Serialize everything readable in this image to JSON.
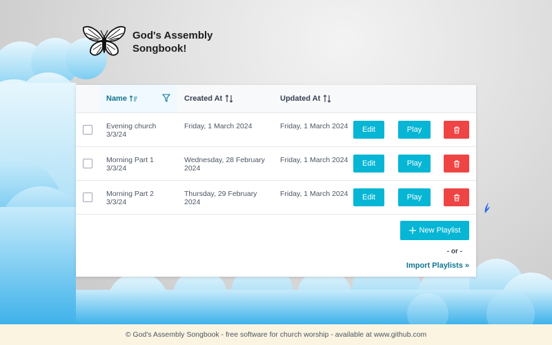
{
  "app": {
    "title": "God's Assembly\nSongbook!"
  },
  "table": {
    "headers": {
      "name": "Name",
      "created": "Created At",
      "updated": "Updated At"
    },
    "rows": [
      {
        "name": "Evening church 3/3/24",
        "created": "Friday, 1 March 2024",
        "updated": "Friday, 1 March 2024"
      },
      {
        "name": "Morning Part 1 3/3/24",
        "created": "Wednesday, 28 February 2024",
        "updated": "Friday, 1 March 2024"
      },
      {
        "name": "Morning Part 2 3/3/24",
        "created": "Thursday, 29 February 2024",
        "updated": "Friday, 1 March 2024"
      }
    ],
    "edit_label": "Edit",
    "play_label": "Play"
  },
  "actions": {
    "new_playlist": "New Playlist",
    "or": "- or -",
    "import": "Import Playlists »"
  },
  "footer": {
    "text": "© God's Assembly Songbook - free software for church worship - available at www.github.com"
  },
  "colors": {
    "accent": "#06b6d4",
    "danger": "#ef4444",
    "link": "#0e7490",
    "footer_bg": "#fbf4e1"
  },
  "icons": [
    "butterfly-logo-icon",
    "sort-icon",
    "filter-icon",
    "trash-icon",
    "plus-icon"
  ]
}
